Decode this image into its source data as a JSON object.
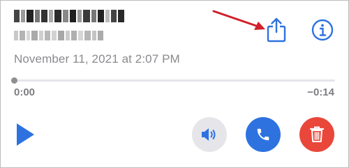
{
  "memo": {
    "date": "November 11, 2021 at 2:07 PM"
  },
  "playback": {
    "elapsed": "0:00",
    "remaining": "−0:14",
    "progress": 0.0
  },
  "icons": {
    "share": "share-icon",
    "info": "info-icon",
    "play": "play-icon",
    "speaker": "speaker-icon",
    "call": "phone-icon",
    "delete": "trash-icon",
    "annotation": "red-arrow-icon"
  },
  "colors": {
    "accent": "#2e72e0",
    "delete": "#e9473a",
    "annotation": "#d0202a"
  }
}
